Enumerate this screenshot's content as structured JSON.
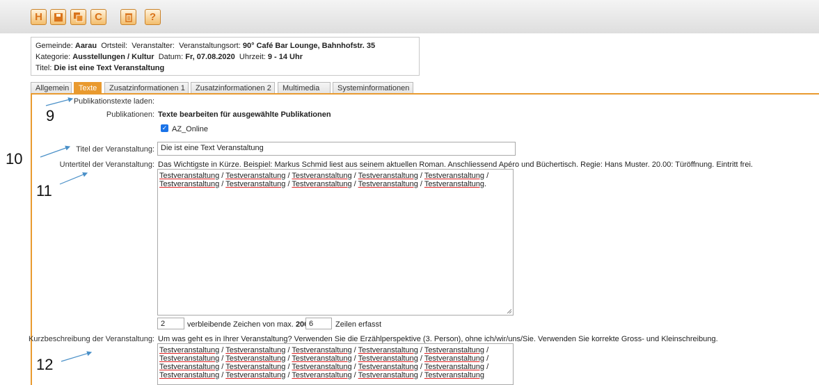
{
  "toolbar": {
    "buttons": [
      {
        "name": "save-icon",
        "glyph": "H"
      },
      {
        "name": "save-close-icon",
        "glyph": ""
      },
      {
        "name": "copy-icon",
        "glyph": ""
      },
      {
        "name": "refresh-icon",
        "glyph": "C"
      },
      {
        "name": "delete-icon",
        "glyph": ""
      },
      {
        "name": "help-icon",
        "glyph": "?"
      }
    ]
  },
  "info": {
    "gemeinde_label": "Gemeinde:",
    "gemeinde_value": "Aarau",
    "ortsteil_label": "Ortsteil:",
    "veranstalter_label": "Veranstalter:",
    "ort_label": "Veranstaltungsort:",
    "ort_value": "90° Café Bar Lounge, Bahnhofstr. 35",
    "kategorie_label": "Kategorie:",
    "kategorie_value": "Ausstellungen / Kultur",
    "datum_label": "Datum:",
    "datum_value": "Fr, 07.08.2020",
    "uhrzeit_label": "Uhrzeit:",
    "uhrzeit_value": "9 - 14 Uhr",
    "titel_label": "Titel:",
    "titel_value": "Die ist eine Text Veranstaltung"
  },
  "tabs": [
    "Allgemein",
    "Texte",
    "Zusatzinformationen 1",
    "Zusatzinformationen 2",
    "Multimedia",
    "Systeminformationen"
  ],
  "form": {
    "pubtexte_label": "Publikationstexte laden:",
    "publikationen_label": "Publikationen:",
    "publikationen_value": "Texte bearbeiten für ausgewählte Publikationen",
    "az_online_label": "AZ_Online",
    "titel_label": "Titel der Veranstaltung:",
    "titel_value": "Die ist eine Text Veranstaltung",
    "untertitel_label": "Untertitel der Veranstaltung:",
    "untertitel_hint": "Das Wichtigste in Kürze. Beispiel: Markus Schmid liest aus seinem aktuellen Roman. Anschliessend Apéro und Büchertisch. Regie: Hans Muster. 20.00: Türöffnung. Eintritt frei.",
    "untertitel_word": "Testveranstaltung",
    "counter_remaining": "2",
    "counter_text": "verbleibende Zeichen von max.",
    "counter_max": "200",
    "counter_lines": "6",
    "counter_lines_text": "Zeilen erfasst",
    "kurz_label": "Kurzbeschreibung der Veranstaltung:",
    "kurz_hint": "Um was geht es in Ihrer Veranstaltung? Verwenden Sie die Erzählperspektive (3. Person), ohne ich/wir/uns/Sie. Verwenden Sie korrekte Gross- und Kleinschreibung.",
    "kurz_word": "Testveranstaltung"
  },
  "callouts": [
    "9",
    "10",
    "11",
    "12"
  ],
  "colors": {
    "accent": "#e99a2f",
    "check": "#1a73e8"
  }
}
